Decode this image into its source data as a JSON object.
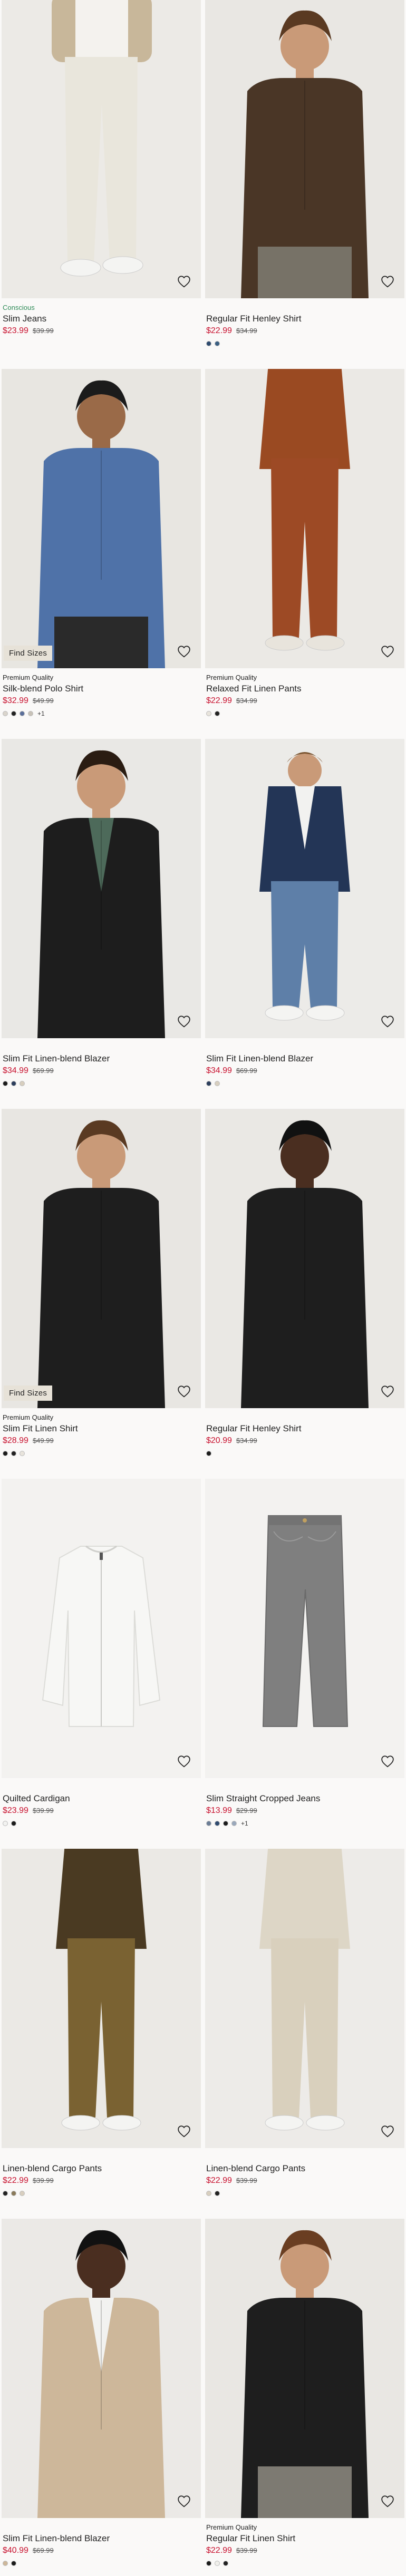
{
  "products": [
    {
      "tag": "Conscious",
      "tag_style": "conscious",
      "title": "Slim Jeans",
      "price": "$23.99",
      "orig": "$39.99",
      "swatches": [],
      "more": "",
      "badge": "",
      "image": "model-white-jeans",
      "bg": "#eceae6"
    },
    {
      "tag": "",
      "tag_style": "",
      "title": "Regular Fit Henley Shirt",
      "price": "$22.99",
      "orig": "$34.99",
      "swatches": [
        "#2d4a6e",
        "#3a5f82"
      ],
      "more": "",
      "badge": "",
      "image": "model-brown-shirt",
      "bg": "#e9e7e3"
    },
    {
      "tag": "Premium Quality",
      "tag_style": "",
      "title": "Silk-blend Polo Shirt",
      "price": "$32.99",
      "orig": "$49.99",
      "swatches": [
        "#d9d4cc",
        "#222222",
        "#5b6f9a",
        "#c8c2b8"
      ],
      "more": "+1",
      "badge": "Find Sizes",
      "image": "model-blue-polo",
      "bg": "#e8e6e1"
    },
    {
      "tag": "Premium Quality",
      "tag_style": "",
      "title": "Relaxed Fit Linen Pants",
      "price": "$22.99",
      "orig": "$34.99",
      "swatches": [
        "#e8e4dc",
        "#222222"
      ],
      "more": "",
      "badge": "",
      "image": "model-rust-outfit",
      "bg": "#ebe9e5"
    },
    {
      "tag": "",
      "tag_style": "",
      "title": "Slim Fit Linen-blend Blazer",
      "price": "$34.99",
      "orig": "$69.99",
      "swatches": [
        "#1b1b1b",
        "#2c3e5c",
        "#d8cfbf"
      ],
      "more": "",
      "badge": "",
      "image": "model-black-blazer",
      "bg": "#e9e8e5"
    },
    {
      "tag": "",
      "tag_style": "",
      "title": "Slim Fit Linen-blend Blazer",
      "price": "$34.99",
      "orig": "$69.99",
      "swatches": [
        "#2c3e5c",
        "#d8cfbf"
      ],
      "more": "",
      "badge": "",
      "image": "model-navy-blazer",
      "bg": "#ecebe8"
    },
    {
      "tag": "Premium Quality",
      "tag_style": "",
      "title": "Slim Fit Linen Shirt",
      "price": "$28.99",
      "orig": "$49.99",
      "swatches": [
        "#1b1b1b",
        "#222222",
        "#e8e4dc"
      ],
      "more": "",
      "badge": "Find Sizes",
      "image": "model-black-linen-shirt",
      "bg": "#e8e6e2"
    },
    {
      "tag": "",
      "tag_style": "",
      "title": "Regular Fit Henley Shirt",
      "price": "$20.99",
      "orig": "$34.99",
      "swatches": [
        "#1b1b1b"
      ],
      "more": "",
      "badge": "",
      "image": "model-black-henley",
      "bg": "#eae8e4"
    },
    {
      "tag": "",
      "tag_style": "",
      "title": "Quilted Cardigan",
      "price": "$23.99",
      "orig": "$39.99",
      "swatches": [
        "#f2f2f0",
        "#1b1b1b"
      ],
      "more": "",
      "badge": "",
      "image": "white-cardigan-flat",
      "bg": "#f3f2f0"
    },
    {
      "tag": "",
      "tag_style": "",
      "title": "Slim Straight Cropped Jeans",
      "price": "$13.99",
      "orig": "$29.99",
      "swatches": [
        "#6b7d96",
        "#2f4a6f",
        "#1b1b1b",
        "#9aa8bb"
      ],
      "more": "+1",
      "badge": "",
      "image": "grey-jeans-flat",
      "bg": "#f3f2f0"
    },
    {
      "tag": "",
      "tag_style": "",
      "title": "Linen-blend Cargo Pants",
      "price": "$22.99",
      "orig": "$39.99",
      "swatches": [
        "#222222",
        "#8a7a5a",
        "#d8cfbf"
      ],
      "more": "",
      "badge": "",
      "image": "model-olive-cargo",
      "bg": "#ebe9e5"
    },
    {
      "tag": "",
      "tag_style": "",
      "title": "Linen-blend Cargo Pants",
      "price": "$22.99",
      "orig": "$39.99",
      "swatches": [
        "#d8cfbf",
        "#222222"
      ],
      "more": "",
      "badge": "",
      "image": "model-beige-cargo",
      "bg": "#edebe8"
    },
    {
      "tag": "",
      "tag_style": "",
      "title": "Slim Fit Linen-blend Blazer",
      "price": "$40.99",
      "orig": "$69.99",
      "swatches": [
        "#cdb79a",
        "#1b1b1b"
      ],
      "more": "",
      "badge": "",
      "image": "model-beige-blazer",
      "bg": "#ebe9e6"
    },
    {
      "tag": "Premium Quality",
      "tag_style": "",
      "title": "Regular Fit Linen Shirt",
      "price": "$22.99",
      "orig": "$39.99",
      "swatches": [
        "#1b1b1b",
        "#f0efeb",
        "#222222"
      ],
      "more": "",
      "badge": "",
      "image": "model-black-shortsleeve",
      "bg": "#e9e7e3"
    }
  ],
  "colors": {
    "sale": "#c8102e",
    "conscious": "#2e8b57",
    "background": "#faf9f8"
  },
  "icons": {
    "wishlist": "heart-icon"
  }
}
